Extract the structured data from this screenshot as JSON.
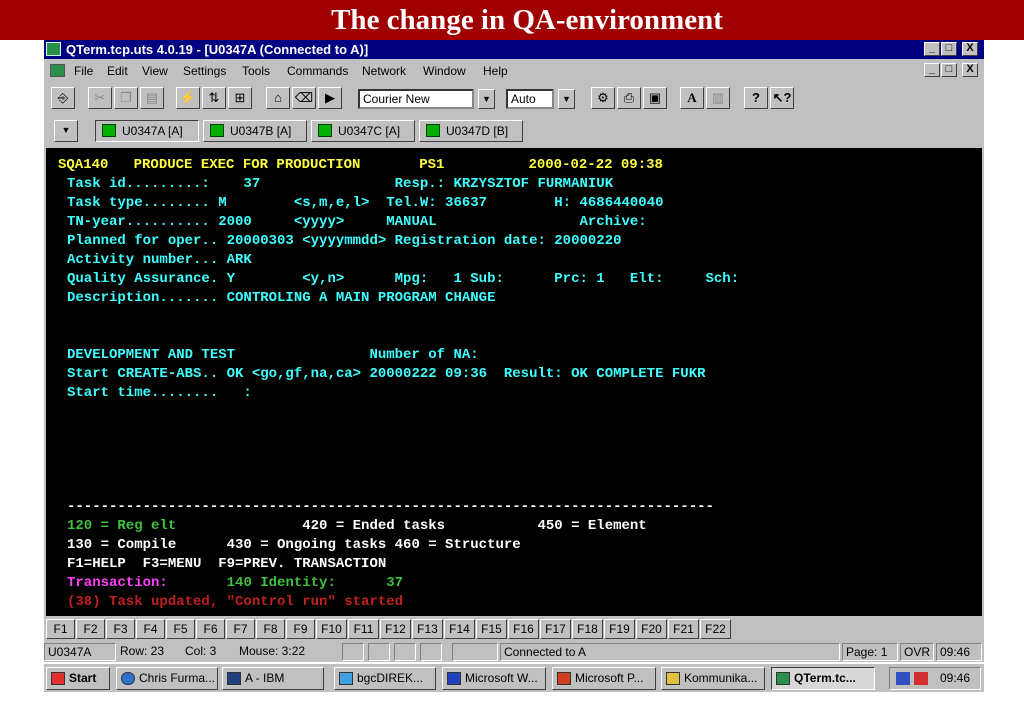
{
  "slide": {
    "title": "The change in QA-environment"
  },
  "window": {
    "title": "QTerm.tcp.uts 4.0.19 - [U0347A (Connected to A)]",
    "controls": [
      "_",
      "□",
      "X"
    ]
  },
  "menu": [
    "File",
    "Edit",
    "View",
    "Settings",
    "Tools",
    "Commands",
    "Network",
    "Window",
    "Help"
  ],
  "toolbar": {
    "font_value": "Courier New",
    "size_value": "Auto"
  },
  "sessions": [
    {
      "label": "U0347A [A]",
      "active": true
    },
    {
      "label": "U0347B [A]",
      "active": false
    },
    {
      "label": "U0347C [A]",
      "active": false
    },
    {
      "label": "U0347D [B]",
      "active": false
    }
  ],
  "terminal": {
    "lines": [
      {
        "text": "SQA140   PRODUCE EXEC FOR PRODUCTION       PS1          2000-02-22 09:38",
        "color": "yellow",
        "indent": 0
      },
      {
        "text": "Task id.........:    37                Resp.: KRZYSZTOF FURMANIUK",
        "color": "cyan",
        "indent": 1
      },
      {
        "text": "Task type........ M        <s,m,e,l>  Tel.W: 36637        H: 4686440040",
        "color": "cyan",
        "indent": 1
      },
      {
        "text": "TN-year.......... 2000     <yyyy>     MANUAL                 Archive:",
        "color": "cyan",
        "indent": 1
      },
      {
        "text": "Planned for oper.. 20000303 <yyyymmdd> Registration date: 20000220",
        "color": "cyan",
        "indent": 1
      },
      {
        "text": "Activity number... ARK",
        "color": "cyan",
        "indent": 1
      },
      {
        "text": "Quality Assurance. Y        <y,n>      Mpg:   1 Sub:      Prc: 1   Elt:     Sch:",
        "color": "cyan",
        "indent": 1
      },
      {
        "text": "Description....... CONTROLING A MAIN PROGRAM CHANGE",
        "color": "cyan",
        "indent": 1
      },
      {
        "text": "",
        "color": "cyan",
        "indent": 1
      },
      {
        "text": "",
        "color": "cyan",
        "indent": 1
      },
      {
        "text": "DEVELOPMENT AND TEST                Number of NA:",
        "color": "cyan",
        "indent": 1
      },
      {
        "text": "Start CREATE-ABS.. OK <go,gf,na,ca> 20000222 09:36  Result: OK COMPLETE FUKR",
        "color": "cyan",
        "indent": 1
      },
      {
        "text": "Start time........   :",
        "color": "cyan",
        "indent": 1
      },
      {
        "text": "",
        "color": "cyan",
        "indent": 1
      },
      {
        "text": "",
        "color": "cyan",
        "indent": 1
      },
      {
        "text": "",
        "color": "cyan",
        "indent": 1
      },
      {
        "text": "",
        "color": "cyan",
        "indent": 1
      },
      {
        "text": "",
        "color": "cyan",
        "indent": 1
      },
      {
        "text": "-----------------------------------------------------------------------------",
        "color": "white",
        "indent": 1
      },
      {
        "text": "",
        "color": "green",
        "indent": 1,
        "segments": [
          {
            "text": "120 = Reg elt               ",
            "color": "green"
          },
          {
            "text": "420 = Ended tasks           450 = Element",
            "color": "white"
          }
        ]
      },
      {
        "text": "130 = Compile      430 = Ongoing tasks 460 = Structure",
        "color": "white",
        "indent": 1
      },
      {
        "text": "F1=HELP  F3=MENU  F9=PREV. TRANSACTION",
        "color": "white",
        "indent": 1
      },
      {
        "text": "",
        "color": "magenta",
        "indent": 1,
        "segments": [
          {
            "text": "Transaction:       ",
            "color": "magenta"
          },
          {
            "text": "140 Identity:      37",
            "color": "green"
          }
        ]
      },
      {
        "text": "(38) Task updated, \"Control run\" started",
        "color": "red",
        "indent": 1
      }
    ]
  },
  "function_keys": [
    "F1",
    "F2",
    "F3",
    "F4",
    "F5",
    "F6",
    "F7",
    "F8",
    "F9",
    "F10",
    "F11",
    "F12",
    "F13",
    "F14",
    "F15",
    "F16",
    "F17",
    "F18",
    "F19",
    "F20",
    "F21",
    "F22"
  ],
  "status": {
    "session": "U0347A",
    "row": "Row: 23",
    "col": "Col: 3",
    "mouse": "Mouse:  3:22",
    "connection": "Connected to A",
    "page": "Page: 1",
    "mode": "OVR",
    "time": "09:46"
  },
  "taskbar": {
    "start": "Start",
    "buttons": [
      "Chris Furma...",
      "A - IBM",
      "bgcDIREK...",
      "Microsoft W...",
      "Microsoft P...",
      "Kommunika...",
      "QTerm.tc..."
    ],
    "clock": "09:46"
  }
}
